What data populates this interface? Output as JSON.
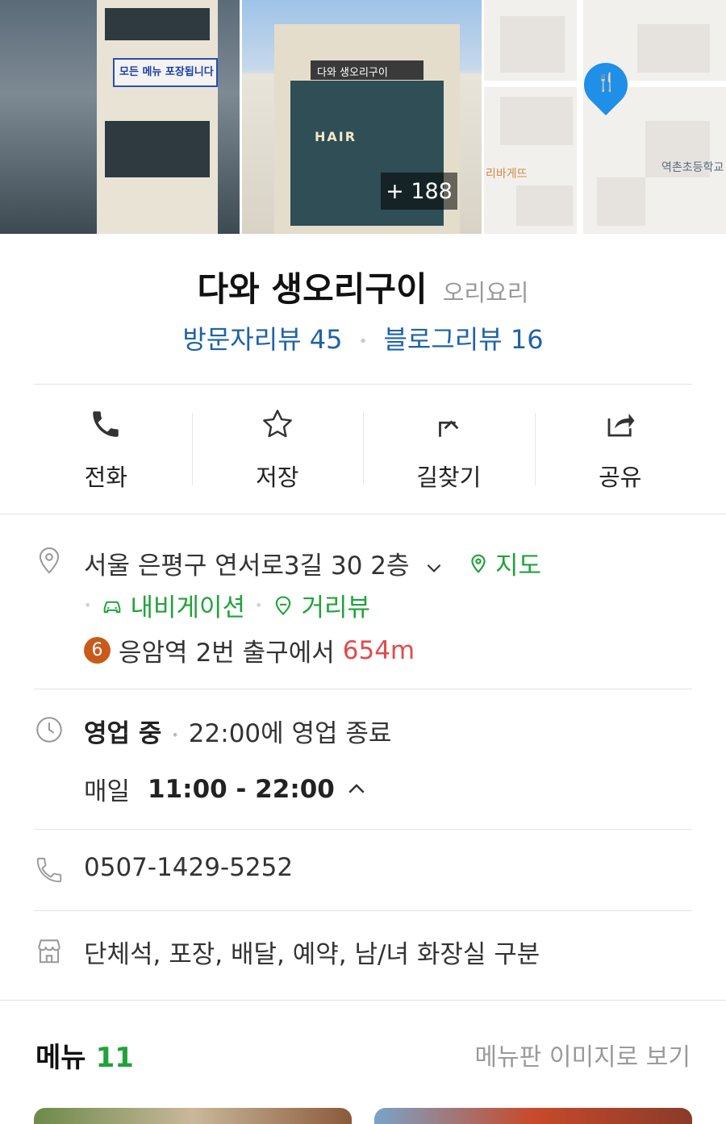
{
  "photos": {
    "banner_text": "모든 메뉴 포장됩니다",
    "sign_text": "다와 생오리구이",
    "hair_text": "HAIR",
    "more_count": "+ 188",
    "map_labels": [
      "리바게뜨",
      "역촌초등학교"
    ]
  },
  "place": {
    "name": "다와 생오리구이",
    "category": "오리요리",
    "visitor_reviews": "방문자리뷰 45",
    "blog_reviews": "블로그리뷰 16"
  },
  "actions": [
    {
      "label": "전화",
      "icon": "phone-icon"
    },
    {
      "label": "저장",
      "icon": "star-icon"
    },
    {
      "label": "길찾기",
      "icon": "directions-icon"
    },
    {
      "label": "공유",
      "icon": "share-icon"
    }
  ],
  "location": {
    "address": "서울 은평구 연서로3길 30 2층",
    "map_link": "지도",
    "navigation": "내비게이션",
    "street_view": "거리뷰",
    "subway_line": "6",
    "subway_station": "응암역",
    "subway_exit": "2번 출구에서",
    "subway_distance": "654m"
  },
  "hours": {
    "status": "영업 중",
    "closing": "22:00에 영업 종료",
    "day": "매일",
    "time": "11:00 - 22:00"
  },
  "phone": "0507-1429-5252",
  "amenities": "단체석, 포장, 배달, 예약, 남/녀 화장실 구분",
  "menu": {
    "title": "메뉴",
    "count": "11",
    "image_link": "메뉴판 이미지로 보기"
  },
  "colors": {
    "accent_green": "#20a33a",
    "review_blue": "#1e62a8",
    "distance_red": "#e34a4a",
    "subway_line6": "#c85b1a",
    "map_pin_blue": "#1f8fe8"
  }
}
